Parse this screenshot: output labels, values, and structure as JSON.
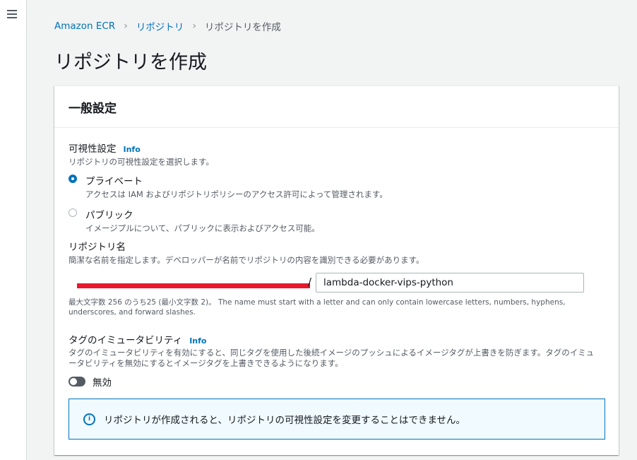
{
  "breadcrumb": {
    "items": [
      "Amazon ECR",
      "リポジトリ"
    ],
    "current": "リポジトリを作成"
  },
  "page": {
    "title": "リポジトリを作成"
  },
  "panel": {
    "title": "一般設定"
  },
  "visibility": {
    "label": "可視性設定",
    "info": "Info",
    "description": "リポジトリの可視性設定を選択します。",
    "options": [
      {
        "label": "プライベート",
        "description": "アクセスは IAM およびリポジトリポリシーのアクセス許可によって管理されます。",
        "selected": true
      },
      {
        "label": "パブリック",
        "description": "イメージプルについて、パブリックに表示およびアクセス可能。",
        "selected": false
      }
    ]
  },
  "repository": {
    "label": "リポジトリ名",
    "description": "簡潔な名前を指定します。デベロッパーが名前でリポジトリの内容を識別できる必要があります。",
    "prefix_separator": "/",
    "value": "lambda-docker-vips-python",
    "constraint": "最大文字数 256 のうち25 (最小文字数 2)。 The name must start with a letter and can only contain lowercase letters, numbers, hyphens, underscores, and forward slashes."
  },
  "tag_immutability": {
    "label": "タグのイミュータビリティ",
    "info": "Info",
    "description": "タグのイミュータビリティを有効にすると、同じタグを使用した後続イメージのプッシュによるイメージタグが上書きを防ぎます。タグのイミュータビリティを無効にするとイメージタグを上書きできるようになります。",
    "toggle_label": "無効",
    "enabled": false
  },
  "alert": {
    "icon": "i",
    "text": "リポジトリが作成されると、リポジトリの可視性設定を変更することはできません。"
  },
  "colors": {
    "accent": "#0073bb",
    "redaction": "#e8192c"
  }
}
